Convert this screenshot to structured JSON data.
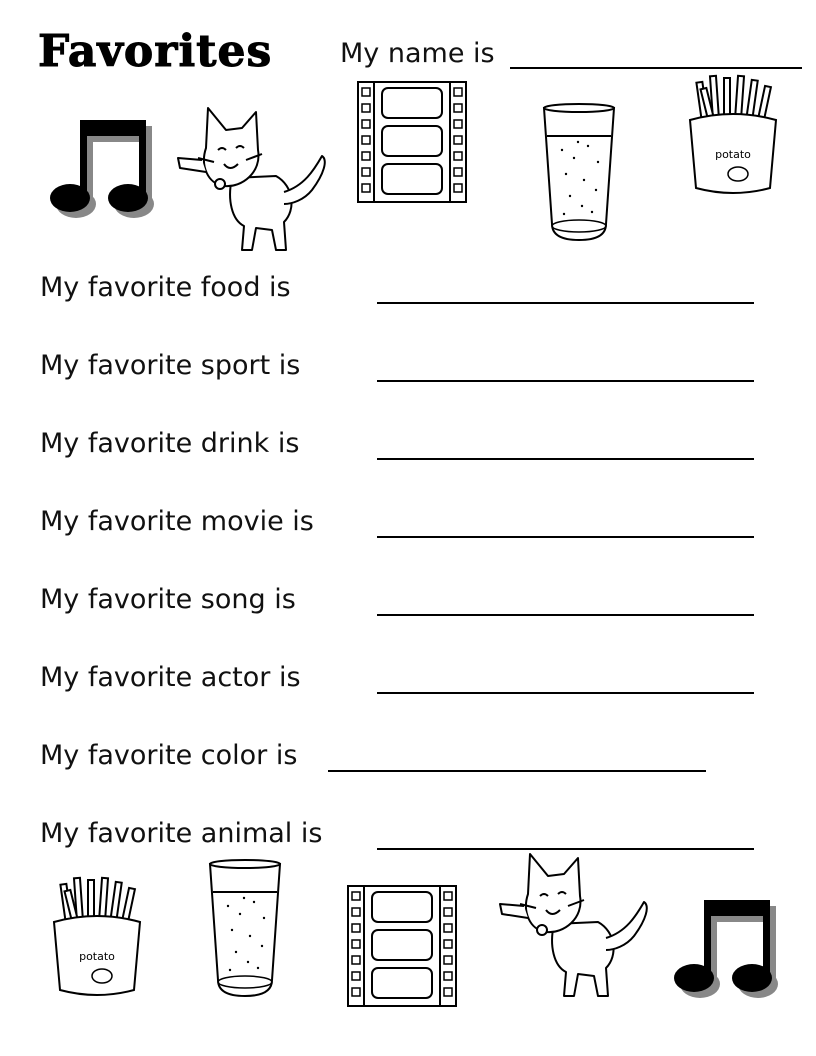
{
  "worksheet": {
    "title": "Favorites",
    "name_prompt": "My name is",
    "rows": [
      {
        "label": "My favorite food is"
      },
      {
        "label": "My favorite sport is"
      },
      {
        "label": "My favorite drink is"
      },
      {
        "label": "My favorite movie is"
      },
      {
        "label": "My favorite song is"
      },
      {
        "label": "My favorite actor is"
      },
      {
        "label": "My favorite color is"
      },
      {
        "label": "My favorite animal is"
      }
    ]
  },
  "illustrations": {
    "potato_text": "potato"
  },
  "icons": [
    "music-note-icon",
    "cat-icon",
    "film-strip-icon",
    "drink-glass-icon",
    "french-fries-icon"
  ]
}
